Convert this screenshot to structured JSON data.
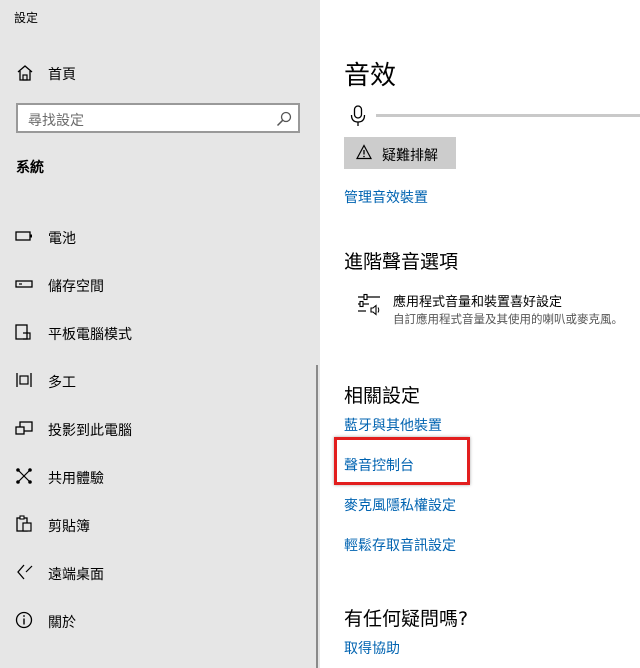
{
  "app": {
    "title": "設定"
  },
  "sidebar": {
    "home_label": "首頁",
    "search_placeholder": "尋找設定",
    "section_title": "系統",
    "items": [
      {
        "label": "電池",
        "icon": "battery-icon"
      },
      {
        "label": "儲存空間",
        "icon": "storage-icon"
      },
      {
        "label": "平板電腦模式",
        "icon": "tablet-mode-icon"
      },
      {
        "label": "多工",
        "icon": "multitasking-icon"
      },
      {
        "label": "投影到此電腦",
        "icon": "project-icon"
      },
      {
        "label": "共用體驗",
        "icon": "shared-experiences-icon"
      },
      {
        "label": "剪貼簿",
        "icon": "clipboard-icon"
      },
      {
        "label": "遠端桌面",
        "icon": "remote-desktop-icon"
      },
      {
        "label": "關於",
        "icon": "info-icon"
      }
    ]
  },
  "main": {
    "title": "音效",
    "troubleshoot_label": "疑難排解",
    "manage_devices_link": "管理音效裝置",
    "advanced": {
      "heading": "進階聲音選項",
      "item_title": "應用程式音量和裝置喜好設定",
      "item_desc": "自訂應用程式音量及其使用的喇叭或麥克風。"
    },
    "related": {
      "heading": "相關設定",
      "links": [
        "藍牙與其他裝置",
        "聲音控制台",
        "麥克風隱私權設定",
        "輕鬆存取音訊設定"
      ]
    },
    "help": {
      "heading": "有任何疑問嗎?",
      "link": "取得協助"
    }
  },
  "colors": {
    "link": "#0063b1",
    "highlight": "#e21e1e",
    "sidebar_bg": "#e6e6e6"
  }
}
